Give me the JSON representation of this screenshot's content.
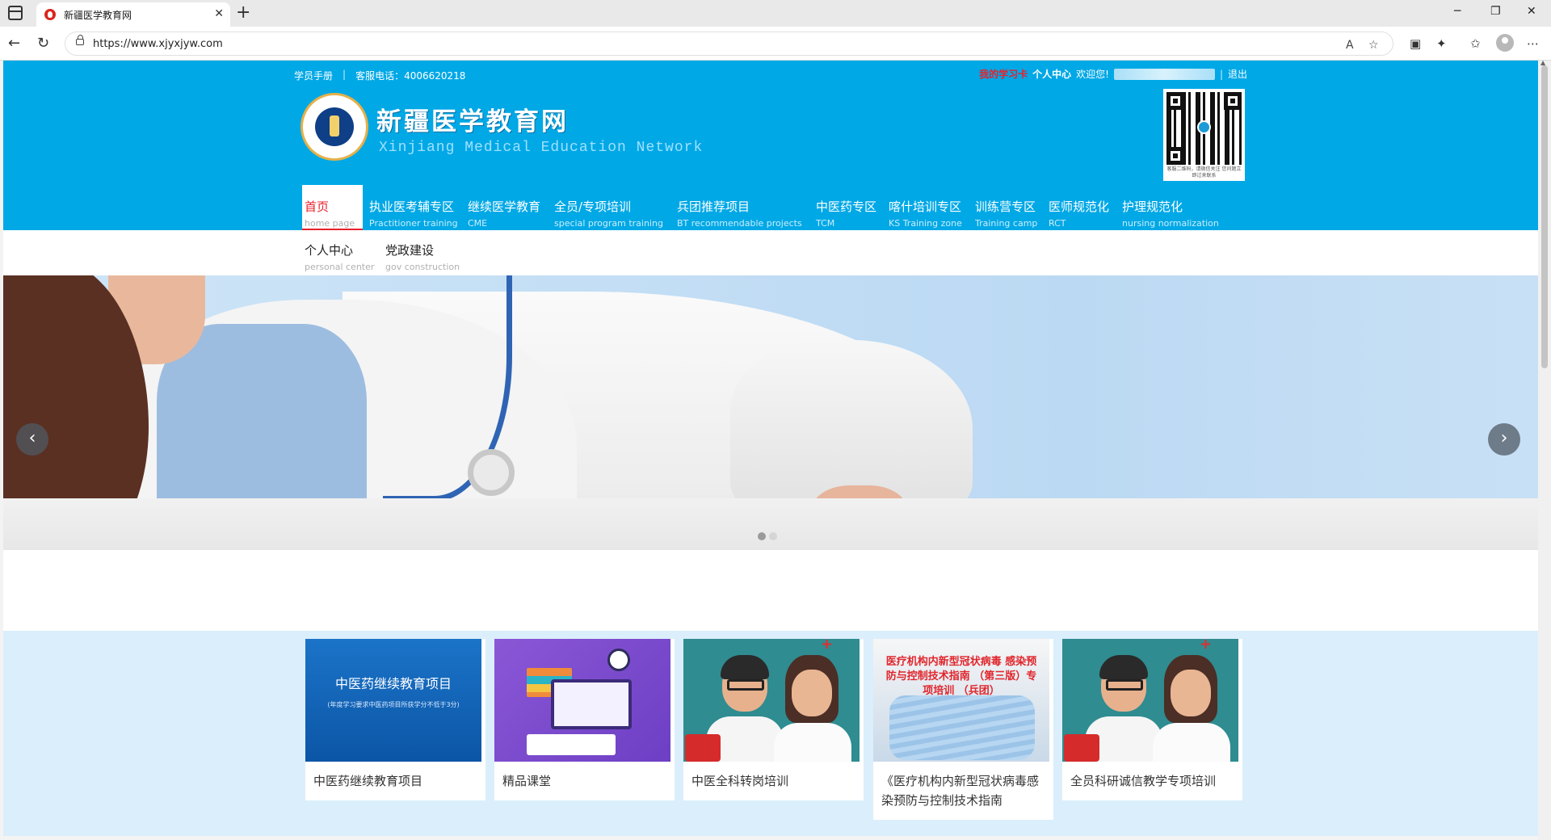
{
  "browser": {
    "tab_title": "新疆医学教育网",
    "url": "https://www.xjyxjyw.com"
  },
  "header": {
    "handbook": "学员手册",
    "hotline": "客服电话：4006620218",
    "my_card": "我的学习卡",
    "personal_center": "个人中心",
    "welcome": "欢迎您!",
    "logout": "退出",
    "title": "新疆医学教育网",
    "subtitle": "Xinjiang Medical Education Network",
    "qr_caption": "客服二维码，请微信关注 您问题立即过来联系"
  },
  "nav": {
    "row1": [
      {
        "cn": "首页",
        "en": "home page",
        "active": true
      },
      {
        "cn": "执业医考辅专区",
        "en": "Practitioner training"
      },
      {
        "cn": "继续医学教育",
        "en": "CME"
      },
      {
        "cn": "全员/专项培训",
        "en": "special program training"
      },
      {
        "cn": "兵团推荐项目",
        "en": "BT recommendable projects"
      },
      {
        "cn": "中医药专区",
        "en": "TCM"
      },
      {
        "cn": "喀什培训专区",
        "en": "KS Training zone"
      },
      {
        "cn": "训练营专区",
        "en": "Training camp"
      },
      {
        "cn": "医师规范化",
        "en": "RCT"
      },
      {
        "cn": "护理规范化",
        "en": "nursing normalization"
      }
    ],
    "row2": [
      {
        "cn": "个人中心",
        "en": "personal center"
      },
      {
        "cn": "党政建设",
        "en": "gov construction"
      }
    ]
  },
  "banner": {
    "prev": "‹",
    "next": "›",
    "slides": 2,
    "current": 1
  },
  "courses": [
    {
      "title": "中医药继续教育项目",
      "thumb_title": "中医药继续教育项目",
      "thumb_note": "(年度学习要求中医药项目所获学分不低于3分)"
    },
    {
      "title": "精品课堂"
    },
    {
      "title": "中医全科转岗培训"
    },
    {
      "title": "《医疗机构内新型冠状病毒感染预防与控制技术指南",
      "thumb_title": "医疗机构内新型冠状病毒 感染预防与控制技术指南 （第三版）专项培训 （兵团）"
    },
    {
      "title": "全员科研诚信教学专项培训"
    }
  ],
  "colors": {
    "brand_blue": "#00a8e6",
    "accent_red": "#e8212b",
    "course_bg": "#dbeefb"
  }
}
